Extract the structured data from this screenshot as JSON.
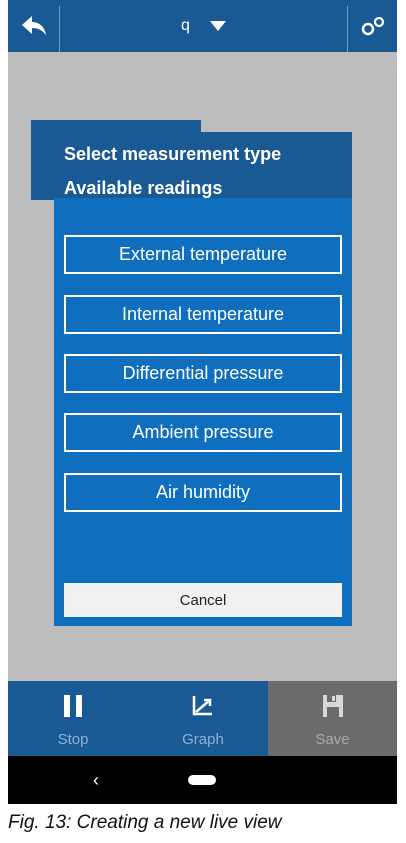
{
  "topbar": {
    "title": "q"
  },
  "icons": {
    "back": "back-arrow-icon",
    "dropdown": "caret-down-icon",
    "settings": "gears-icon",
    "stop": "pause-icon",
    "graph": "graph-icon",
    "save": "save-icon"
  },
  "dialog": {
    "title": "Select measurement type",
    "subtitle": "Available readings",
    "options": [
      "External temperature",
      "Internal temperature",
      "Differential pressure",
      "Ambient pressure",
      "Air humidity"
    ],
    "cancel_label": "Cancel"
  },
  "toolbar": {
    "stop_label": "Stop",
    "graph_label": "Graph",
    "save_label": "Save"
  },
  "navbar": {
    "back_glyph": "‹"
  },
  "caption": "Fig. 13: Creating a new live view",
  "colors": {
    "header_blue": "#1a5a94",
    "dialog_blue": "#0f6fbe",
    "overlay_gray": "#bdbdbd",
    "disabled_gray": "#6b6b6b"
  }
}
